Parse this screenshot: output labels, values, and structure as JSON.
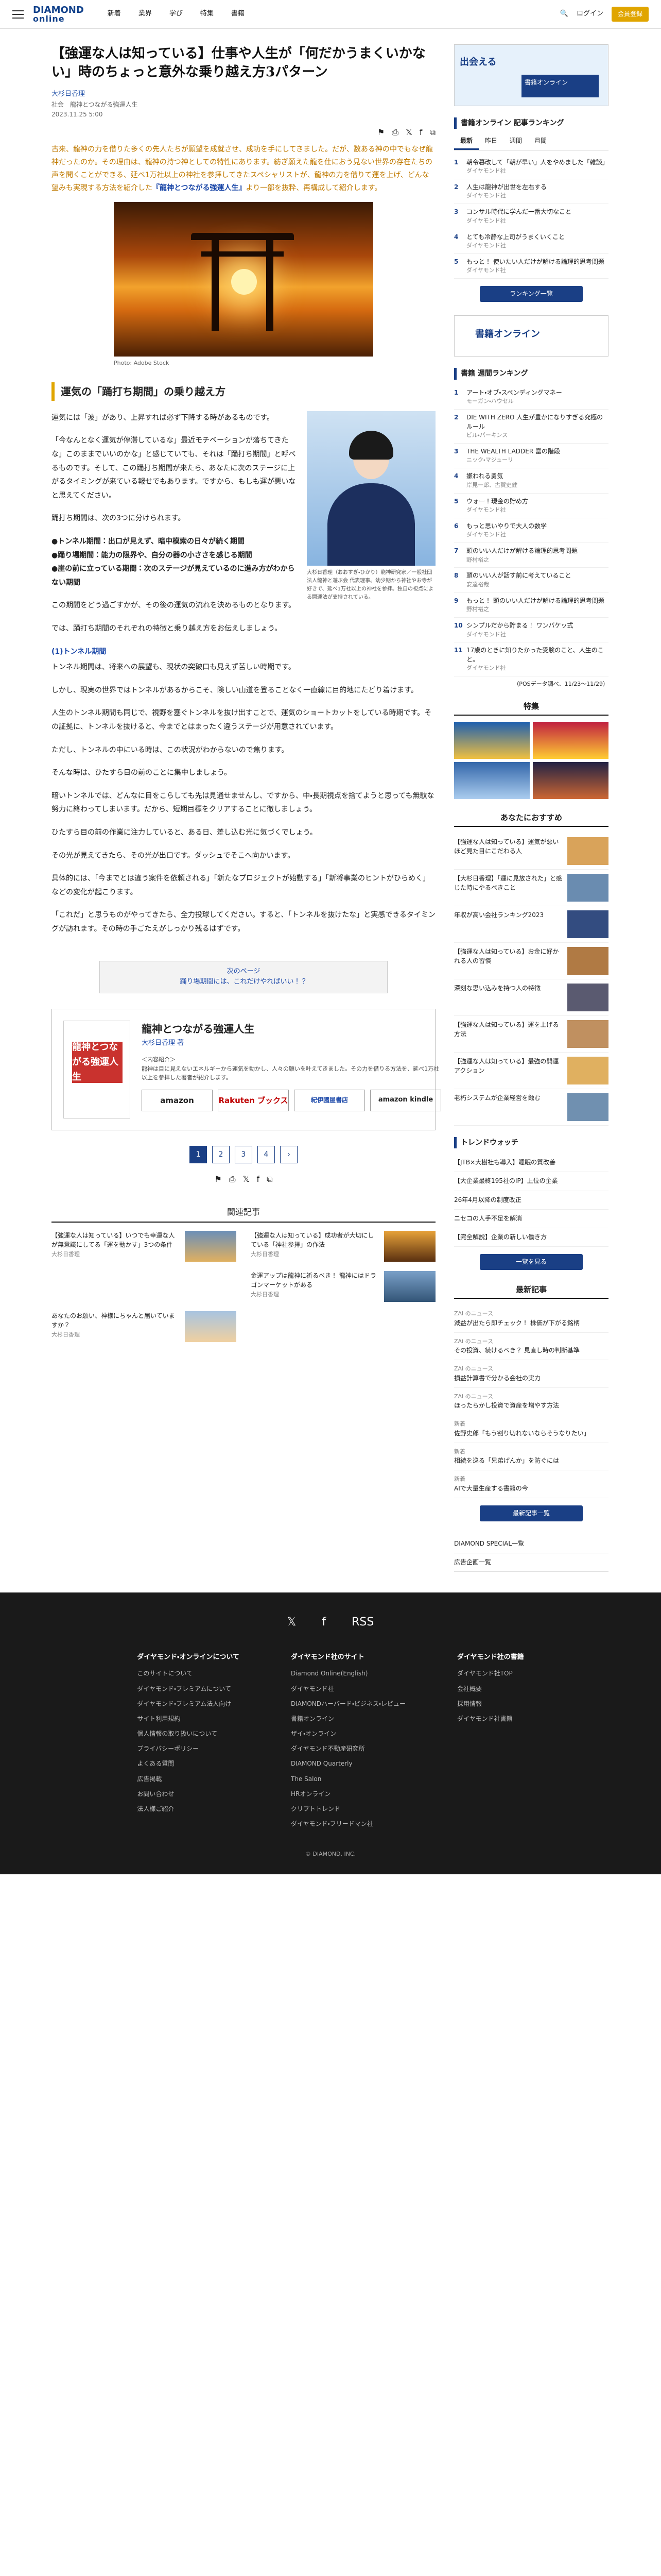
{
  "header": {
    "logo_top": "DIAMOND",
    "logo_bottom": "online",
    "nav": [
      "新着",
      "業界",
      "学び",
      "特集",
      "書籍"
    ],
    "login": "ログイン",
    "member": "会員登録"
  },
  "article": {
    "title": "【強運な人は知っている】仕事や人生が「何だかうまくいかない」時のちょっと意外な乗り越え方3パターン",
    "author": "大杉日香理",
    "book_line": "社会　龍神とつながる強運人生",
    "date": "2023.11.25 5:00",
    "lead": "古来、龍神の力を借りた多くの先人たちが願望を成就させ、成功を手にしてきました。だが、数ある神の中でもなぜ龍神だったのか。その理由は、龍神の持つ神としての特性にあります。紡ぎ願えた龍を仕におう見ない世界の存在たちの声を聞くことができる、延べ1万社以上の神社を参拝してきたスペシャリストが、龍神の力を借りて運を上げ、どんな望みも実現する方法を紹介した",
    "lead_link": "『龍神とつながる強運人生』",
    "lead_tail": "より一部を抜粋、再構成して紹介します。",
    "photo_caption": "Photo: Adobe Stock",
    "section": "運気の「踊打ち期間」の乗り越え方",
    "p1": "運気には「波」があり、上昇すれば必ず下降する時があるものです。",
    "p2": "「今なんとなく運気が停滞しているな」最近モチベーションが落ちてきたな」このままでいいのかな」と感じていても、それは「踊打ち期間」と呼べるものです。そして、この踊打ち期間が来たら、あなたに次のステージに上がるタイミングが来ている報せでもあります。ですから、もしも運が悪いなと思えてください。",
    "p3": "踊打ち期間は、次の3つに分けられます。",
    "p4_1": "●トンネル期間：出口が見えず、暗中模索の日々が続く期間",
    "p4_2": "●踊り場期間：能力の限界や、自分の器の小ささを感じる期間",
    "p4_3": "●崖の前に立っている期間：次のステージが見えているのに進み方がわからない期間",
    "p5": "この期間をどう過ごすかが、その後の運気の流れを決めるものとなります。",
    "p6": "では、踊打ち期間のそれぞれの特徴と乗り越え方をお伝えしましょう。",
    "sub1": "(1)トンネル期間",
    "p7": "トンネル期間は、将来への展望も、現状の突破口も見えず苦しい時期です。",
    "p8": "しかし、現実の世界ではトンネルがあるからこそ、険しい山道を登ることなく一直線に目的地にたどり着けます。",
    "p9": "人生のトンネル期間も同じで、視野を塞ぐトンネルを抜け出すことで、運気のショートカットをしている時期です。その証拠に、トンネルを抜けると、今までとはまったく違うステージが用意されています。",
    "p10": "ただし、トンネルの中にいる時は、この状況がわからないので焦ります。",
    "p11": "そんな時は、ひたすら目の前のことに集中しましょう。",
    "p12": "暗いトンネルでは、どんなに目をこらしても先は見通せませんし、ですから、中・長期視点を捨てようと思っても無駄な努力に終わってしまいます。だから、短期目標をクリアすることに徹しましょう。",
    "p13": "ひたすら目の前の作業に注力していると、ある日、差し込む光に気づくでしょう。",
    "p14": "その光が見えてきたら、その光が出口です。ダッシュでそこへ向かいます。",
    "p15": "具体的には、「今までとは違う案件を依頼される」「新たなプロジェクトが始動する」「新将事業のヒントがひらめく」などの変化が起こります。",
    "p16": "「これだ」と思うものがやってきたら、全力投球してください。すると、「トンネルを抜けたな」と実感できるタイミングが訪れます。その時の手ごたえがしっかり残るはずです。",
    "profile": "大杉日香理（おおすぎ・ひかり）龍神研究家／一般社団法人龍神と遊ぶ会 代表理事。幼少期から神社やお寺が好きで、延べ1万社以上の神社を参拝。独自の視点による開運法が支持されている。",
    "next": "次のページ",
    "next_text": "踊り場期間には、これだけやればいい！？",
    "book_title": "龍神とつながる強運人生",
    "book_author": "大杉日香理 著",
    "book_cover": "龍神とつながる強運人生",
    "book_desc_h": "＜内容紹介＞",
    "book_desc": "龍神は目に見えないエネルギーから運気を動かし、人々の願いを叶えてきました。その力を借りる方法を、延べ1万社以上を参拝した著者が紹介します。",
    "shops": [
      "amazon",
      "Rakuten ブックス",
      "紀伊國屋書店",
      "amazon kindle"
    ],
    "pages": [
      "1",
      "2",
      "3",
      "4",
      "›"
    ]
  },
  "related": {
    "heading": "関連記事",
    "items": [
      {
        "t": "【強運な人は知っている】いつでも幸運な人が無意識にしてる「運を動かす」3つの条件",
        "a": "大杉日香理"
      },
      {
        "t": "【強運な人は知っている】成功者が大切にしている「神社参拝」の作法",
        "a": "大杉日香理"
      },
      {
        "t": "",
        "a": ""
      },
      {
        "t": "金運アップは龍神に祈るべき！ 龍神にはドラゴンマーケットがある",
        "a": "大杉日香理"
      },
      {
        "t": "あなたのお願い、神様にちゃんと届いていますか？",
        "a": "大杉日香理"
      }
    ]
  },
  "side": {
    "ad1_head": "出会える",
    "ad1_sub": "書籍オンライン",
    "rank_h": "書籍オンライン 記事ランキング",
    "tabs": [
      "最新",
      "昨日",
      "週間",
      "月間"
    ],
    "ranking": [
      {
        "t": "朝令暮改して「朝が早い」人をやめました「雑談」",
        "s": "ダイヤモンド社"
      },
      {
        "t": "人生は龍神が出世を左右する",
        "s": "ダイヤモンド社"
      },
      {
        "t": "コンサル時代に学んだ一番大切なこと",
        "s": "ダイヤモンド社"
      },
      {
        "t": "とても冷静な上司がうまくいくこと",
        "s": "ダイヤモンド社"
      },
      {
        "t": "もっと！ 使いたい人だけが解ける論理的思考問題",
        "s": "ダイヤモンド社"
      }
    ],
    "rank_more": "ランキング一覧",
    "ad2": "書籍オンライン",
    "weekly_h": "書籍 週間ランキング",
    "weekly": [
      {
        "t": "アート・オブ・スペンディングマネー",
        "s": "モーガン・ハウセル"
      },
      {
        "t": "DIE WITH ZERO 人生が豊かになりすぎる究極のルール",
        "s": "ビル・パーキンス"
      },
      {
        "t": "THE WEALTH LADDER 富の階段",
        "s": "ニック・マジューリ"
      },
      {
        "t": "嫌われる勇気",
        "s": "岸見一郎、古賀史健"
      },
      {
        "t": "ウォー！現金の貯め方",
        "s": "ダイヤモンド社"
      },
      {
        "t": "もっと思いやりで大人の数学",
        "s": "ダイヤモンド社"
      },
      {
        "t": "頭のいい人だけが解ける論理的思考問題",
        "s": "野村裕之"
      },
      {
        "t": "頭のいい人が話す前に考えていること",
        "s": "安達裕哉"
      },
      {
        "t": "もっと！ 頭のいい人だけが解ける論理的思考問題",
        "s": "野村裕之"
      },
      {
        "t": "シンプルだから貯まる！ ワンバケッ式",
        "s": "ダイヤモンド社"
      },
      {
        "t": "17歳のときに知りたかった受験のこと、人生のこと。",
        "s": "ダイヤモンド社"
      }
    ],
    "weekly_note": "（POSデータ調べ、11/23〜11/29）",
    "feature_h": "特集",
    "rec_h": "あなたにおすすめ",
    "rec": [
      "【強運な人は知っている】運気が悪いほど見た目にこだわる人",
      "【大杉日香理】「運に見放された」と感じた時にやるべきこと",
      "年収が高い会社ランキング2023",
      "【強運な人は知っている】お金に好かれる人の習慣",
      "深刻な思い込みを持つ人の特徴",
      "【強運な人は知っている】運を上げる方法",
      "【強運な人は知っている】最強の開運アクション",
      "老朽システムが企業経営を蝕む"
    ],
    "trend_h": "トレンドウォッチ",
    "trend": [
      "【JTB×大樹社も導入】睡眠の質改善",
      "【大企業最終195社のIP】上位の企業",
      "26年4月以降の制度改正",
      "ニセコの人手不足を解消",
      "【完全解説】企業の新しい働き方"
    ],
    "trend_more": "一覧を見る",
    "latest_h": "最新記事",
    "latest": [
      {
        "c": "ZAi のニュース",
        "t": "減益が出たら即チェック！ 株価が下がる銘柄"
      },
      {
        "c": "ZAi のニュース",
        "t": "その投資、続けるべき？ 見直し時の判断基準"
      },
      {
        "c": "ZAi のニュース",
        "t": "損益計算書で分かる会社の実力"
      },
      {
        "c": "ZAi のニュース",
        "t": "ほったらかし投資で資産を増やす方法"
      },
      {
        "c": "新着",
        "t": "佐野史郎「もう割り切れないならそうなりたい」"
      },
      {
        "c": "新着",
        "t": "相続を巡る「兄弟げんか」を防ぐには"
      },
      {
        "c": "新着",
        "t": "AIで大量生産する書籍の今"
      }
    ],
    "latest_more": "最新記事一覧",
    "special": "DIAMOND SPECIAL一覧",
    "ads": "広告企画一覧"
  },
  "footer": {
    "social": [
      "𝕏",
      "f",
      "RSS"
    ],
    "col1_h": "ダイヤモンド・オンラインについて",
    "col1": [
      "このサイトについて",
      "ダイヤモンド・プレミアムについて",
      "ダイヤモンド・プレミアム法人向け",
      "サイト利用規約",
      "個人情報の取り扱いについて",
      "プライバシーポリシー",
      "よくある質問",
      "広告掲載",
      "お問い合わせ",
      "法人様ご紹介"
    ],
    "col2_h": "ダイヤモンド社のサイト",
    "col2": [
      "Diamond Online(English)",
      "ダイヤモンド社",
      "DIAMONDハーバード・ビジネス・レビュー",
      "書籍オンライン",
      "ザイ・オンライン",
      "ダイヤモンド不動産研究所",
      "DIAMOND Quarterly",
      "The Salon",
      "HRオンライン",
      "クリプトトレンド",
      "ダイヤモンド・フリードマン社"
    ],
    "col3_h": "ダイヤモンド社の書籍",
    "col3": [
      "ダイヤモンド社TOP",
      "会社概要",
      "採用情報",
      "ダイヤモンド社書籍"
    ],
    "copy": "© DIAMOND, INC."
  }
}
